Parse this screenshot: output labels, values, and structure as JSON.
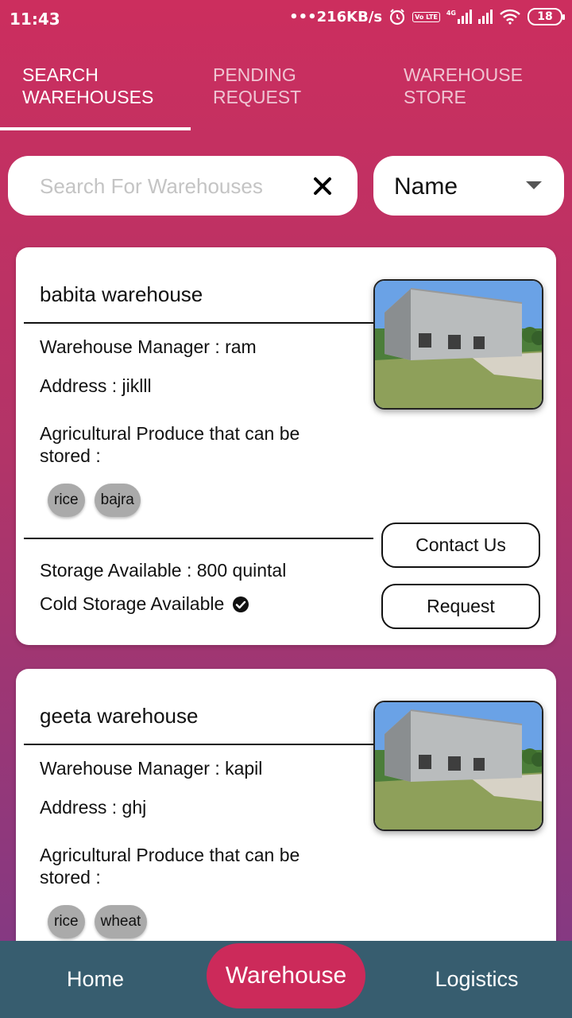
{
  "status_bar": {
    "time": "11:43",
    "network_speed": "•••216KB/s",
    "battery": "18",
    "volte": "Vo LTE",
    "network_type": "4G"
  },
  "tabs": [
    {
      "label": "SEARCH WAREHOUSES",
      "active": true
    },
    {
      "label": "PENDING REQUEST",
      "active": false
    },
    {
      "label": "WAREHOUSE STORE",
      "active": false
    }
  ],
  "search": {
    "placeholder": "Search For Warehouses",
    "value": ""
  },
  "sort": {
    "selected": "Name"
  },
  "warehouses": [
    {
      "name": "babita warehouse",
      "manager": "Warehouse Manager : ram",
      "address": "Address : jiklll",
      "produce_label": "Agricultural Produce that can be stored :",
      "produce": [
        "rice",
        "bajra"
      ],
      "storage": "Storage Available :  800 quintal",
      "cold_storage": "Cold Storage Available",
      "contact_label": "Contact Us",
      "request_label": "Request"
    },
    {
      "name": "geeta warehouse",
      "manager": "Warehouse Manager : kapil",
      "address": "Address : ghj",
      "produce_label": "Agricultural Produce that can be stored :",
      "produce": [
        "rice",
        "wheat"
      ]
    }
  ],
  "bottom_nav": {
    "home": "Home",
    "warehouse": "Warehouse",
    "logistics": "Logistics"
  },
  "colors": {
    "gradient_top": "#cc2e5e",
    "gradient_bottom": "#7e3a86",
    "nav_bg": "#375d6f",
    "nav_active": "#cc2a5a"
  }
}
